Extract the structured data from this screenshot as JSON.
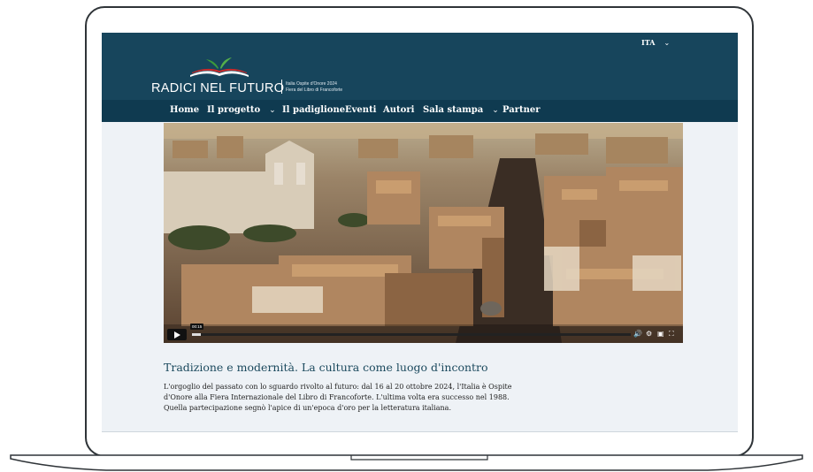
{
  "site": {
    "language": "ITA",
    "logo_text": "RADICI NEL FUTURO",
    "logo_sub_line1": "Italia Ospite d'Onore 2024",
    "logo_sub_line2": "Fiera del Libro di Francoforte",
    "brand_color": "#17455c",
    "nav_color": "#0f3a50"
  },
  "nav": {
    "items": [
      "Home",
      "Il progetto",
      "Il padiglione",
      "Eventi",
      "Autori",
      "Sala stampa",
      "Partner"
    ]
  },
  "video": {
    "timestamp": "00:15",
    "progress": 0.02,
    "icons": [
      "volume-icon",
      "settings-icon",
      "pip-icon",
      "fullscreen-icon"
    ]
  },
  "article": {
    "title": "Tradizione e modernità. La cultura come luogo d'incontro",
    "body": "L'orgoglio del passato con lo sguardo rivolto al futuro: dal 16 al 20 ottobre 2024, l'Italia è Ospite d'Onore alla Fiera Internazionale del Libro di Francoforte. L'ultima volta era successo nel 1988. Quella partecipazione segnò l'apice di un'epoca d'oro per la letteratura italiana."
  }
}
